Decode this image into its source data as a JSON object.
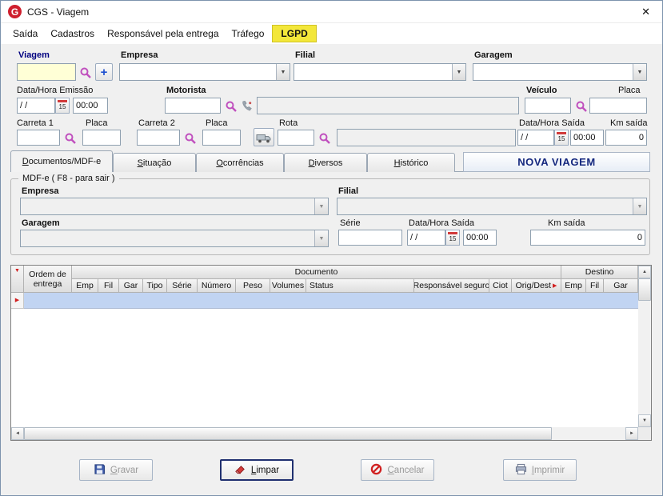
{
  "window": {
    "title": "CGS - Viagem"
  },
  "icons": {
    "logo_letter": "G",
    "close_glyph": "✕",
    "add_glyph": "+",
    "calendar_day": "15",
    "dropdown_glyph": "▼",
    "up_glyph": "▲",
    "down_glyph": "▼",
    "left_glyph": "◄",
    "right_glyph": "►",
    "marker_right_glyph": "▶",
    "marker_down_glyph": "▼"
  },
  "menu": {
    "items": [
      {
        "label": "Saída"
      },
      {
        "label": "Cadastros"
      },
      {
        "label": "Responsável pela entrega"
      },
      {
        "label": "Tráfego"
      },
      {
        "label": "LGPD"
      }
    ]
  },
  "form": {
    "viagem_label": "Viagem",
    "viagem_value": "",
    "empresa_label": "Empresa",
    "empresa_value": "",
    "filial_label": "Filial",
    "filial_value": "",
    "garagem_label": "Garagem",
    "garagem_value": "",
    "data_hora_emissao_label": "Data/Hora Emissão",
    "emissao_date": "/ /",
    "emissao_time": "00:00",
    "motorista_label": "Motorista",
    "motorista_value": "",
    "motorista_desc": "",
    "veiculo_label": "Veículo",
    "veiculo_value": "",
    "placa_label": "Placa",
    "placa_value": "",
    "carreta1_label": "Carreta 1",
    "carreta1_value": "",
    "carreta1_placa_label": "Placa",
    "carreta1_placa_value": "",
    "carreta2_label": "Carreta 2",
    "carreta2_value": "",
    "carreta2_placa_label": "Placa",
    "carreta2_placa_value": "",
    "rota_label": "Rota",
    "rota_value": "",
    "rota_desc": "",
    "data_hora_saida_label": "Data/Hora Saída",
    "saida_date": "/ /",
    "saida_time": "00:00",
    "km_saida_label": "Km saída",
    "km_saida_value": "0"
  },
  "tabs": [
    {
      "key": "D",
      "rest": "ocumentos/MDF-e",
      "active": true
    },
    {
      "key": "S",
      "rest": "ituação",
      "active": false
    },
    {
      "key": "O",
      "rest": "corrências",
      "active": false
    },
    {
      "key": "D",
      "rest": "iversos",
      "active": false
    },
    {
      "key": "H",
      "rest": "istórico",
      "active": false
    }
  ],
  "status_banner": "NOVA VIAGEM",
  "mdfe": {
    "title": "MDF-e ( F8 - para sair )",
    "empresa_label": "Empresa",
    "empresa_value": "",
    "filial_label": "Filial",
    "filial_value": "",
    "garagem_label": "Garagem",
    "garagem_value": "",
    "serie_label": "Série",
    "serie_value": "",
    "data_hora_saida_label": "Data/Hora Saída",
    "saida_date": "/ /",
    "saida_time": "00:00",
    "km_saida_label": "Km saída",
    "km_saida_value": "0"
  },
  "grid": {
    "ordem_header_line1": "Ordem de",
    "ordem_header_line2": "entrega",
    "documento_group": "Documento",
    "destino_group": "Destino",
    "documento_columns": [
      "Emp",
      "Fil",
      "Gar",
      "Tipo",
      "Série",
      "Número",
      "Peso",
      "Volumes",
      "Status",
      "Responsável seguro",
      "Ciot",
      "Orig/Dest"
    ],
    "destino_columns": [
      "Emp",
      "Fil",
      "Gar"
    ]
  },
  "action_buttons": [
    {
      "key": "G",
      "rest": "ravar",
      "enabled": false
    },
    {
      "key": "L",
      "rest": "impar",
      "enabled": true
    },
    {
      "key": "C",
      "rest": "ancelar",
      "enabled": false
    },
    {
      "key": "I",
      "rest": "mprimir",
      "enabled": false
    }
  ]
}
